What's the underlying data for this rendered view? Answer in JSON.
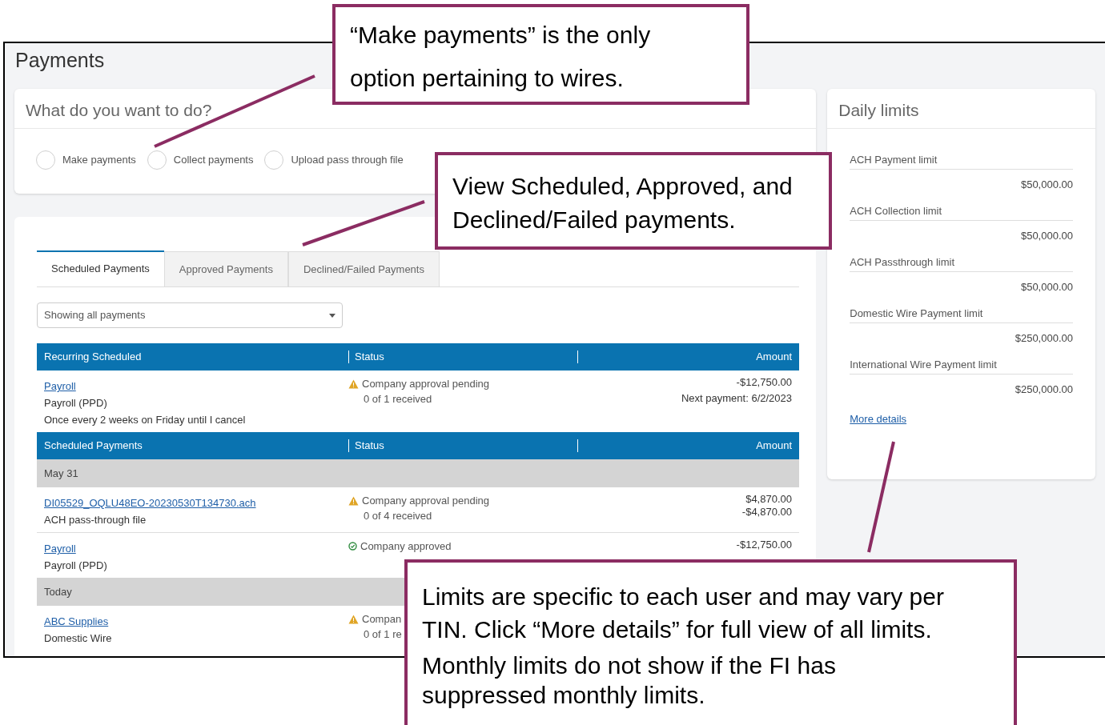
{
  "page": {
    "title": "Payments"
  },
  "what_to_do": {
    "title": "What do you want to do?",
    "options": [
      {
        "label": "Make payments",
        "selected": false
      },
      {
        "label": "Collect payments",
        "selected": false
      },
      {
        "label": "Upload pass through file",
        "selected": false
      }
    ]
  },
  "tabs": [
    {
      "label": "Scheduled Payments",
      "selected": true
    },
    {
      "label": "Approved Payments",
      "selected": false
    },
    {
      "label": "Declined/Failed Payments",
      "selected": false
    }
  ],
  "filter": {
    "value": "Showing all payments"
  },
  "table_sections": [
    {
      "columns": [
        "Recurring Scheduled",
        "Status",
        "Amount"
      ],
      "items": [
        {
          "kind": "payment",
          "link": "Payroll",
          "lines": [
            "Payroll (PPD)",
            "Once every 2 weeks on Friday until I cancel"
          ],
          "status": {
            "kind": "warning",
            "text": "Company approval pending",
            "detail": "0 of 1 received"
          },
          "amounts": [
            "-$12,750.00",
            "Next payment: 6/2/2023"
          ]
        }
      ]
    },
    {
      "columns": [
        "Scheduled Payments",
        "Status",
        "Amount"
      ],
      "items": [
        {
          "kind": "date",
          "label": "May 31"
        },
        {
          "kind": "payment",
          "link": "DI05529_OQLU48EO-20230530T134730.ach",
          "lines": [
            "ACH pass-through file"
          ],
          "status": {
            "kind": "warning",
            "text": "Company approval pending",
            "detail": "0 of 4 received"
          },
          "amounts": [
            "$4,870.00",
            "-$4,870.00"
          ]
        },
        {
          "kind": "payment",
          "link": "Payroll",
          "lines": [
            "Payroll (PPD)"
          ],
          "status": {
            "kind": "approved",
            "text": "Company approved"
          },
          "amounts": [
            "-$12,750.00"
          ]
        },
        {
          "kind": "date",
          "label": "Today"
        },
        {
          "kind": "payment",
          "link": "ABC Supplies",
          "lines": [
            "Domestic Wire"
          ],
          "status": {
            "kind": "warning",
            "text": "Compan",
            "detail": "0 of 1 re"
          }
        }
      ]
    }
  ],
  "daily_limits": {
    "title": "Daily limits",
    "items": [
      {
        "label": "ACH Payment limit",
        "value": "$50,000.00"
      },
      {
        "label": "ACH Collection limit",
        "value": "$50,000.00"
      },
      {
        "label": "ACH Passthrough limit",
        "value": "$50,000.00"
      },
      {
        "label": "Domestic Wire Payment limit",
        "value": "$250,000.00"
      },
      {
        "label": "International Wire Payment limit",
        "value": "$250,000.00"
      }
    ],
    "link": "More details"
  },
  "callouts": [
    {
      "paragraphs": [
        "“Make payments” is the only option pertaining to wires."
      ]
    },
    {
      "paragraphs": [
        "View Scheduled,  Approved, and Declined/Failed payments."
      ]
    },
    {
      "paragraphs": [
        "Limits are specific to each user and may vary per TIN. Click “More details” for full view of all limits.",
        "Monthly limits do not show if the FI has suppressed monthly limits."
      ]
    }
  ]
}
